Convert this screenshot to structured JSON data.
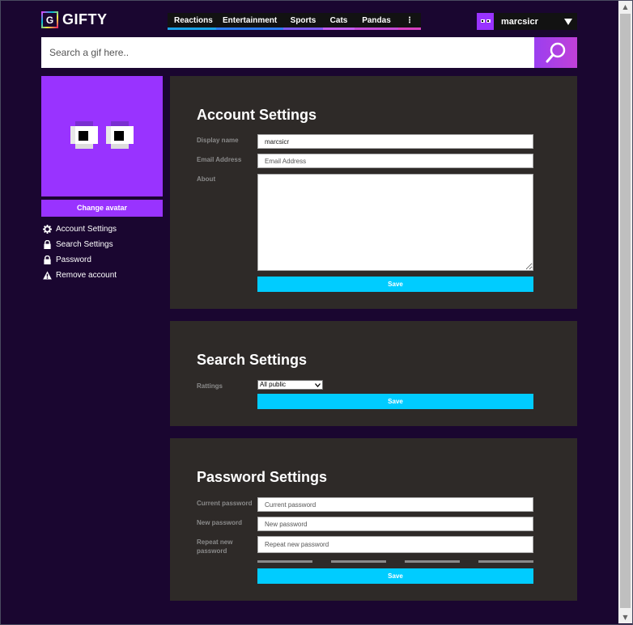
{
  "app": {
    "logo_letter": "G",
    "name": "GIFTY"
  },
  "nav": {
    "items": [
      {
        "label": "Reactions",
        "color": "#1aa3e8"
      },
      {
        "label": "Entertainment",
        "color": "#2e7cf0"
      },
      {
        "label": "Sports",
        "color": "#7d5af0"
      },
      {
        "label": "Cats",
        "color": "#c45ef0"
      },
      {
        "label": "Pandas",
        "color": "#c54cd6"
      },
      {
        "label": "⋮",
        "color": "#d840c0"
      }
    ]
  },
  "user": {
    "name": "marcsicr"
  },
  "search": {
    "placeholder": "Search a gif here.."
  },
  "sidebar": {
    "change_avatar": "Change avatar",
    "items": [
      {
        "label": "Account Settings",
        "icon": "gear-icon"
      },
      {
        "label": "Search Settings",
        "icon": "lock-icon"
      },
      {
        "label": "Password",
        "icon": "lock-icon"
      },
      {
        "label": "Remove account",
        "icon": "warning-icon"
      }
    ]
  },
  "account": {
    "title": "Account Settings",
    "display_name_label": "Display name",
    "display_name_value": "marcsicr",
    "email_label": "Email Address",
    "email_placeholder": "Email Address",
    "about_label": "About",
    "save_label": "Save"
  },
  "search_settings": {
    "title": "Search Settings",
    "ratings_label": "Rattings",
    "ratings_value": "All public",
    "save_label": "Save"
  },
  "password": {
    "title": "Password Settings",
    "current_label": "Current password",
    "current_placeholder": "Current password",
    "new_label": "New password",
    "new_placeholder": "New password",
    "repeat_label": "Repeat new password",
    "repeat_placeholder": "Repeat new password",
    "save_label": "Save"
  },
  "colors": {
    "accent": "#9933ff",
    "save": "#00ccff",
    "panel": "#2e2a28",
    "background": "#1a0630"
  }
}
